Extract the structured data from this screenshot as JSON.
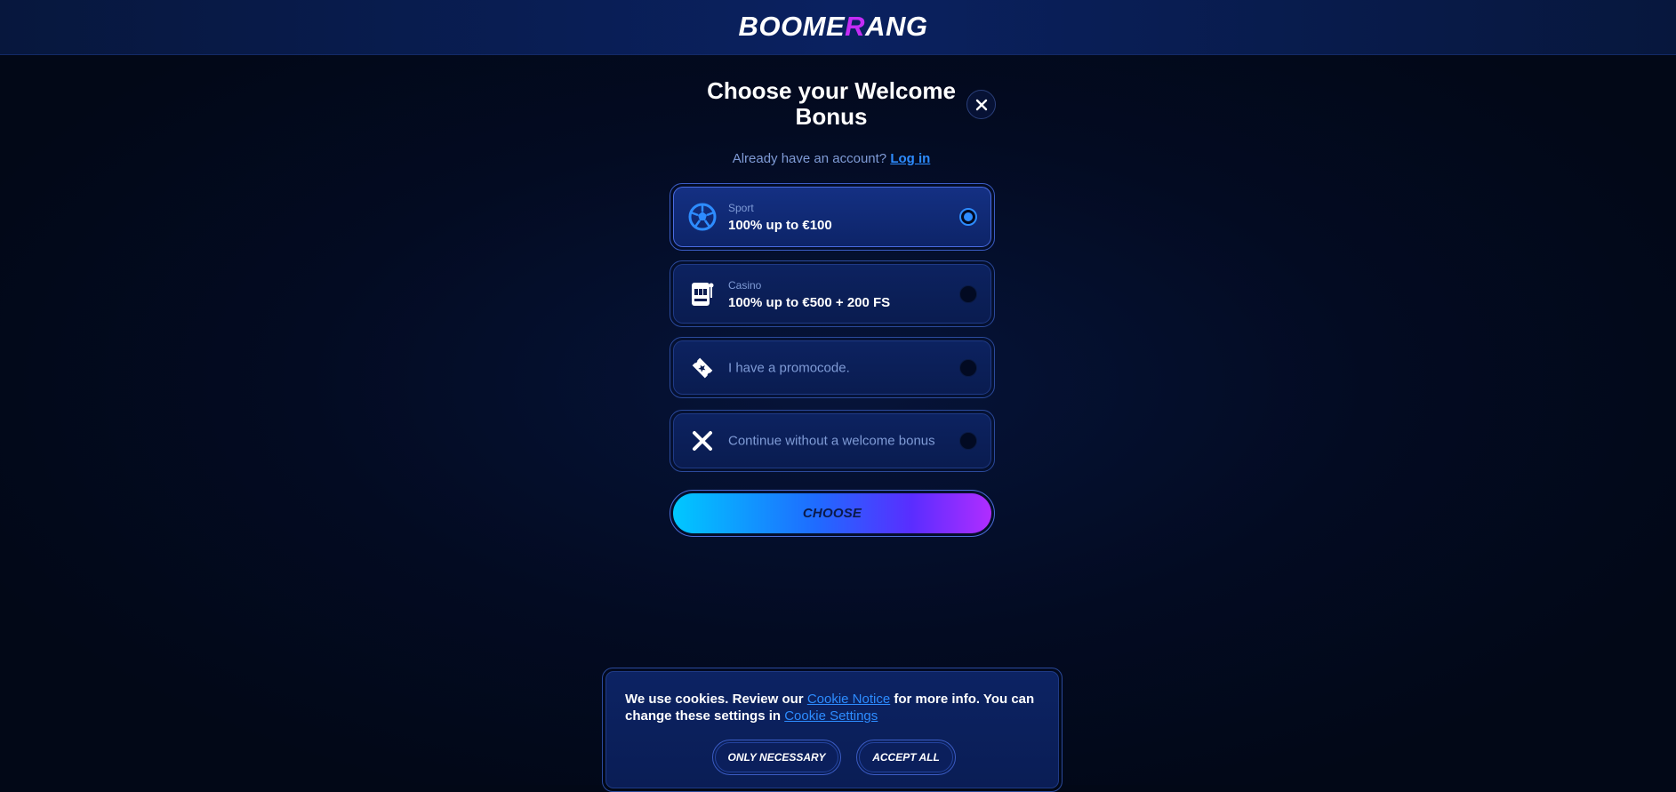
{
  "header": {
    "logo_left": "BOOME",
    "logo_accent": "R",
    "logo_right": "ANG"
  },
  "modal": {
    "title": "Choose your Welcome Bonus",
    "account_prompt": "Already have an account?",
    "login_link": "Log in",
    "options": [
      {
        "icon": "soccer-ball-icon",
        "category": "Sport",
        "label": "100% up to €100",
        "selected": true
      },
      {
        "icon": "slot-machine-icon",
        "category": "Casino",
        "label": "100% up to €500 + 200 FS",
        "selected": false
      },
      {
        "icon": "ticket-icon",
        "label": "I have a promocode.",
        "selected": false
      },
      {
        "icon": "close-icon",
        "label": "Continue without a welcome bonus",
        "selected": false
      }
    ],
    "choose_button": "CHOOSE"
  },
  "cookie_banner": {
    "text_1": "We use cookies. Review our",
    "link_notice": "Cookie Notice",
    "text_2": "for more info. You can change these settings in",
    "link_settings": "Cookie Settings",
    "only_necessary": "ONLY NECESSARY",
    "accept_all": "ACCEPT ALL"
  },
  "colors": {
    "accent_blue": "#2d8cff",
    "logo_accent": "#c32cf5",
    "background": "#020817"
  }
}
